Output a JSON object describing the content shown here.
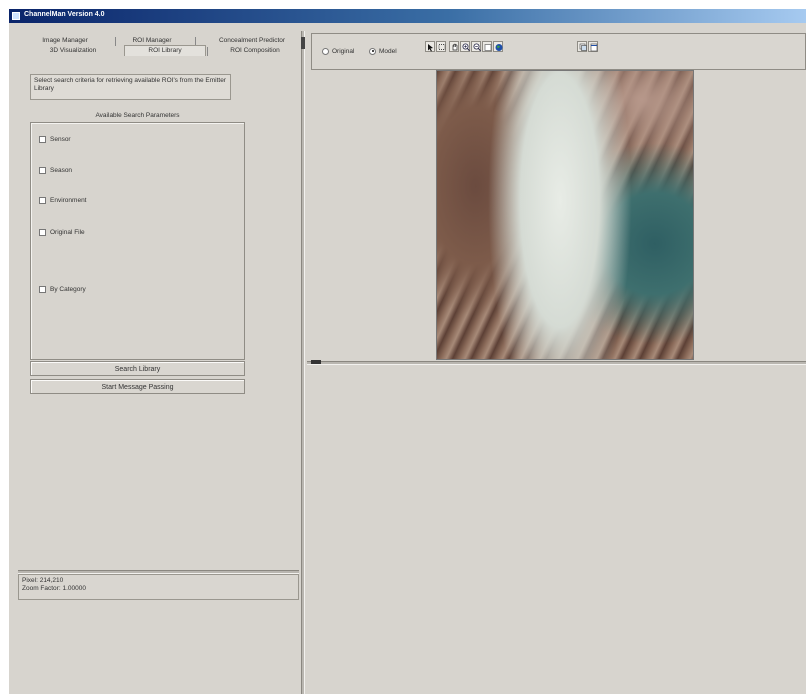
{
  "window": {
    "title": "ChannelMan Version 4.0"
  },
  "tabs": {
    "row1": [
      "Image Manager",
      "ROI Manager",
      "Concealment Predictor"
    ],
    "row2": [
      "3D Visualization",
      "ROI Library",
      "ROI Composition"
    ],
    "selected": "ROI Library"
  },
  "roi_library": {
    "description": "Select search criteria for retrieving available ROI's from the Emitter Library",
    "group_title": "Available Search Parameters",
    "checkboxes": [
      "Sensor",
      "Season",
      "Environment",
      "Original File",
      "By Category"
    ],
    "search_button": "Search Library",
    "message_button": "Start Message Passing"
  },
  "status": {
    "pixel": "Pixel: 214,210",
    "zoom": "Zoom Factor: 1.00000"
  },
  "view_mode": {
    "options": [
      "Original",
      "Model"
    ],
    "selected": "Model"
  },
  "toolbar_icons": [
    "pointer-icon",
    "rectangle-select-icon",
    "pan-icon",
    "zoom-in-icon",
    "zoom-out-icon",
    "zoom-fit-icon",
    "globe-icon",
    "layers-icon",
    "window-icon"
  ],
  "colors": {
    "title_start": "#0a246a",
    "title_end": "#a6caf0",
    "panel_bg": "#d7d4ce"
  }
}
